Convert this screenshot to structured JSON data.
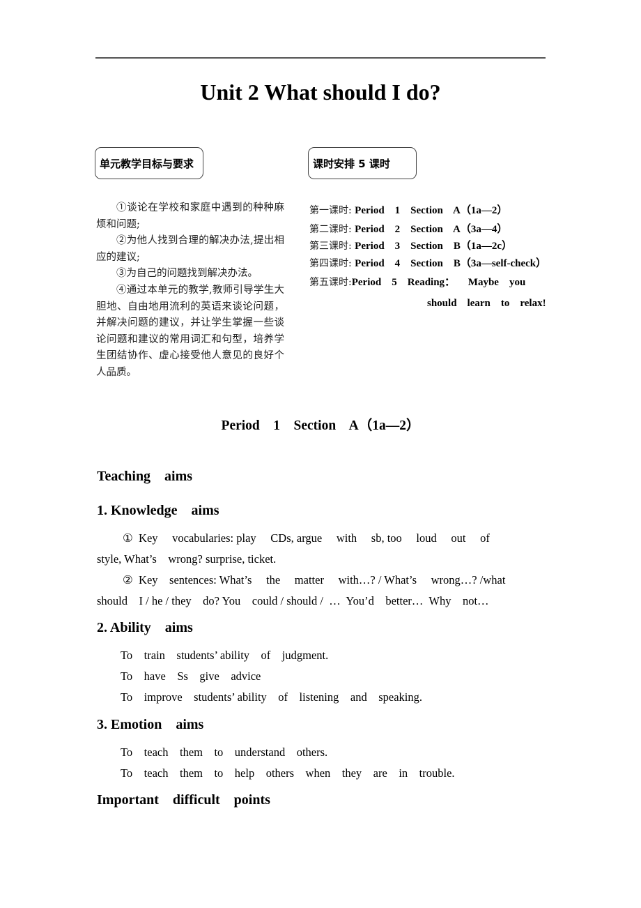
{
  "header": {
    "title": "Unit 2 What should I do?"
  },
  "unit_goals": {
    "label": "单元教学目标与要求",
    "items": [
      "①谈论在学校和家庭中遇到的种种麻烦和问题;",
      "②为他人找到合理的解决办法,提出相应的建议;",
      "③为自己的问题找到解决办法。",
      "④通过本单元的教学,教师引导学生大胆地、自由地用流利的英语来谈论问题，并解决问题的建议，并让学生掌握一些谈论问题和建议的常用词汇和句型，培养学生团结协作、虚心接受他人意见的良好个人品质。"
    ]
  },
  "schedule": {
    "label": "课时安排 5 课时",
    "rows": [
      {
        "cn": "第一课时: ",
        "en": "Period    1    Section    A（1a—2）"
      },
      {
        "cn": "第二课时: ",
        "en": "Period    2    Section    A（3a—4）"
      },
      {
        "cn": "第三课时: ",
        "en": "Period    3    Section    B（1a—2c）"
      },
      {
        "cn": "第四课时: ",
        "en": "Period    4    Section    B（3a—self-check）"
      },
      {
        "cn": "第五课时:",
        "en": "Period    5    Reading：     Maybe    you"
      }
    ],
    "row5_continuation": "should    learn    to    relax!"
  },
  "period": {
    "title": "Period    1    Section    A（1a—2）",
    "teaching_aims_heading": "Teaching    aims",
    "knowledge": {
      "heading": "1. Knowledge    aims",
      "lines": [
        "①  Key     vocabularies: play     CDs, argue     with     sb, too     loud     out     of",
        "style, What’s    wrong? surprise, ticket.",
        "②  Key    sentences: What’s     the     matter     with…? / What’s     wrong…? /what",
        "should    I / he / they    do? You    could / should /  …  You’d    better…  Why    not…"
      ]
    },
    "ability": {
      "heading": "2. Ability    aims",
      "lines": [
        "To    train    students’ ability    of    judgment.",
        "To    have    Ss    give    advice",
        "To    improve    students’ ability    of    listening    and    speaking."
      ]
    },
    "emotion": {
      "heading": "3. Emotion    aims",
      "lines": [
        "To    teach    them    to    understand    others.",
        "To    teach    them    to    help    others    when    they    are    in    trouble."
      ]
    },
    "important_heading": "Important    difficult    points"
  }
}
